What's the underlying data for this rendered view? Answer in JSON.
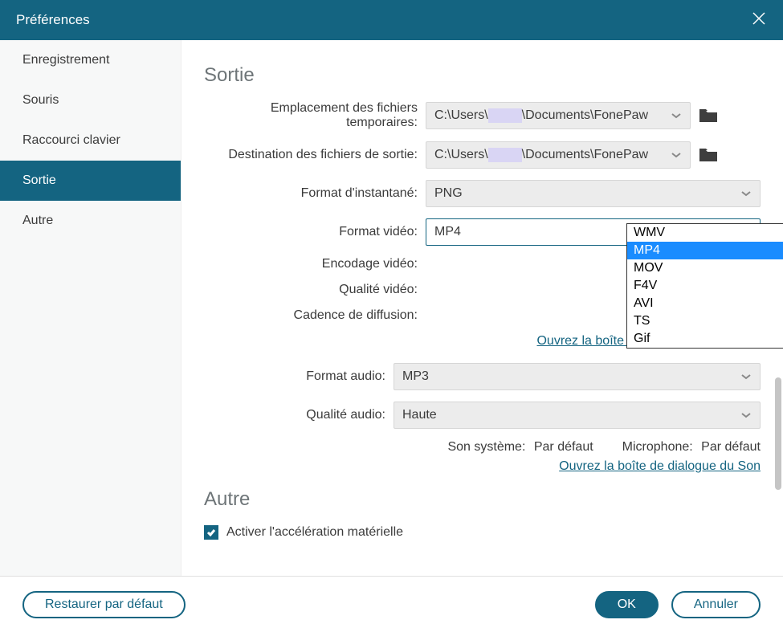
{
  "window": {
    "title": "Préférences"
  },
  "sidebar": {
    "items": [
      {
        "label": "Enregistrement"
      },
      {
        "label": "Souris"
      },
      {
        "label": "Raccourci clavier"
      },
      {
        "label": "Sortie"
      },
      {
        "label": "Autre"
      }
    ],
    "active_index": 3
  },
  "sections": {
    "output_title": "Sortie",
    "other_title": "Autre"
  },
  "fields": {
    "temp_loc_label": "Emplacement des fichiers temporaires:",
    "temp_loc_value_prefix": "C:\\Users\\",
    "temp_loc_value_suffix": "\\Documents\\FonePaw",
    "output_loc_label": "Destination des fichiers de sortie:",
    "output_loc_value_prefix": "C:\\Users\\",
    "output_loc_value_suffix": "\\Documents\\FonePaw",
    "snapshot_fmt_label": "Format d'instantané:",
    "snapshot_fmt_value": "PNG",
    "video_fmt_label": "Format vidéo:",
    "video_fmt_value": "MP4",
    "video_enc_label": "Encodage vidéo:",
    "video_qual_label": "Qualité vidéo:",
    "framerate_label": "Cadence de diffusion:",
    "audio_fmt_label": "Format audio:",
    "audio_fmt_value": "MP3",
    "audio_qual_label": "Qualité audio:",
    "audio_qual_value": "Haute",
    "sys_sound_label": "Son système:",
    "sys_sound_value": "Par défaut",
    "mic_label": "Microphone:",
    "mic_value": "Par défaut",
    "hw_accel_label": "Activer l'accélération matérielle"
  },
  "video_format_options": [
    "WMV",
    "MP4",
    "MOV",
    "F4V",
    "AVI",
    "TS",
    "Gif"
  ],
  "video_format_selected_index": 1,
  "links": {
    "display_dialog": "Ouvrez la boîte de dialogue d'Affichage",
    "sound_dialog": "Ouvrez la boîte de dialogue du Son"
  },
  "footer": {
    "restore": "Restaurer par défaut",
    "ok": "OK",
    "cancel": "Annuler"
  }
}
